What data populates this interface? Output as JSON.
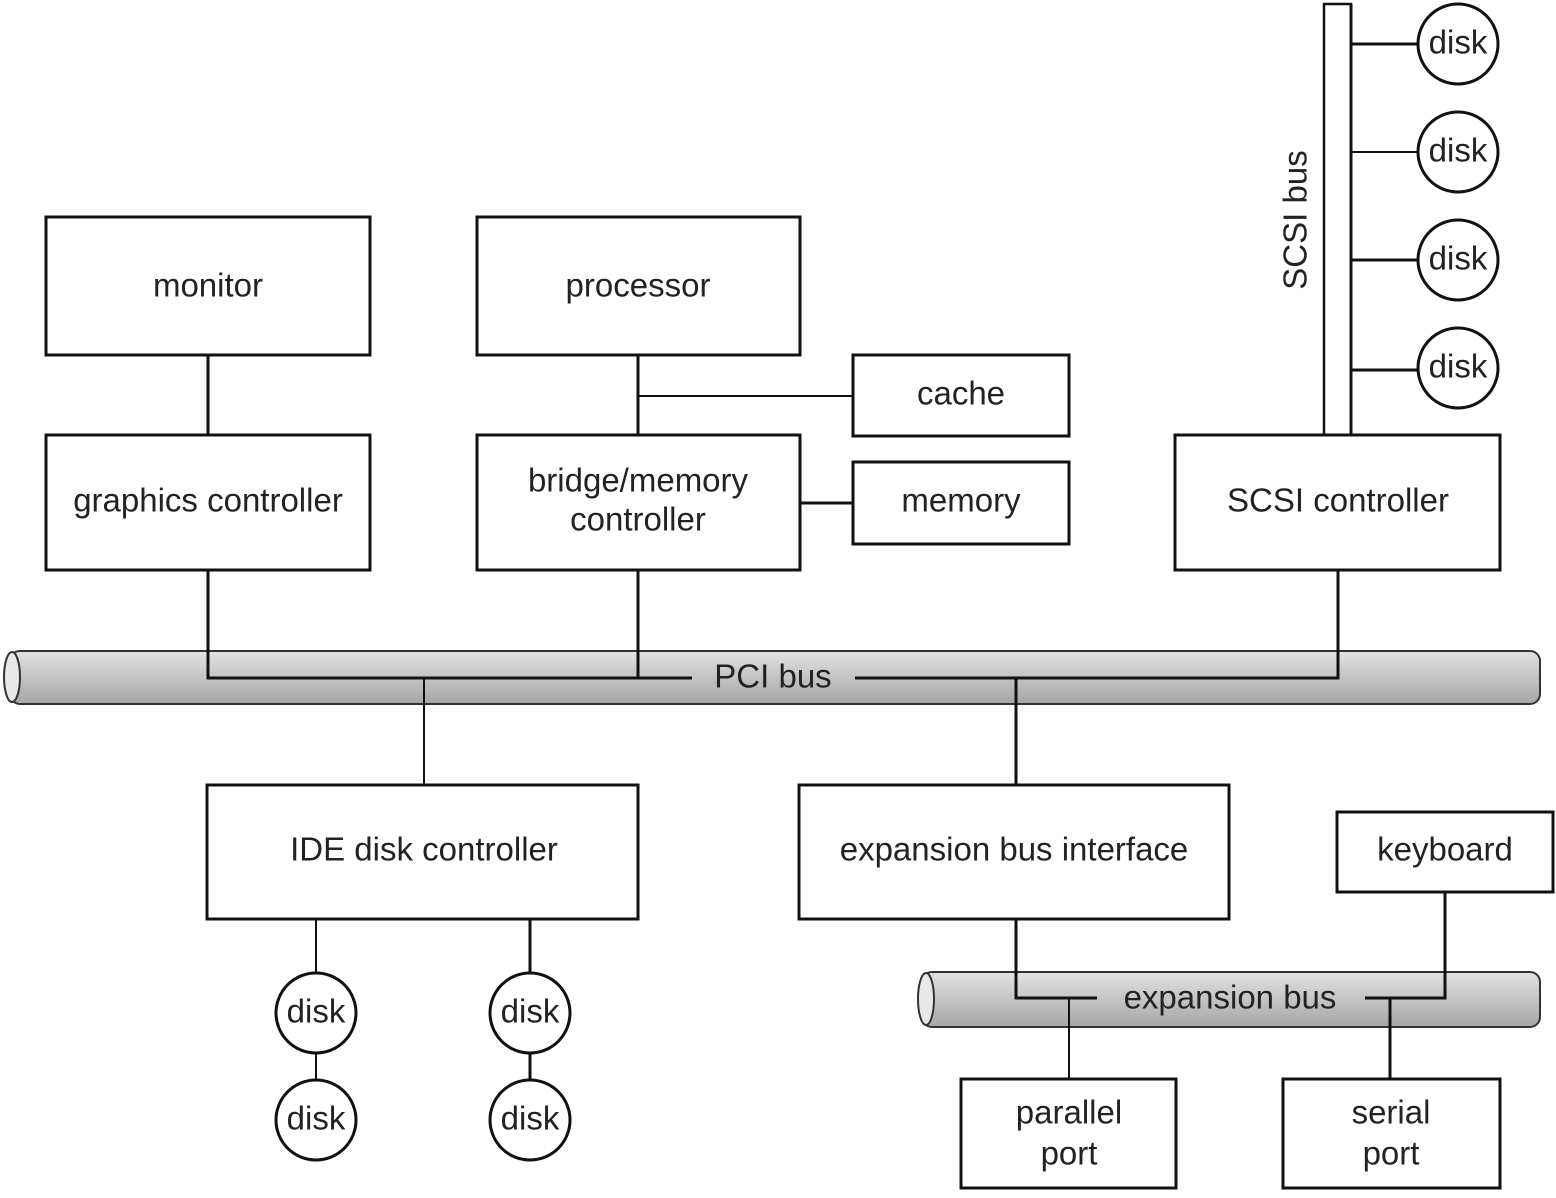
{
  "components": {
    "monitor": "monitor",
    "graphics_controller": "graphics controller",
    "processor": "processor",
    "cache": "cache",
    "bridge_line1": "bridge/memory",
    "bridge_line2": "controller",
    "memory": "memory",
    "scsi_controller": "SCSI controller",
    "ide_controller": "IDE disk controller",
    "expansion_interface": "expansion bus interface",
    "keyboard": "keyboard",
    "parallel_line1": "parallel",
    "parallel_line2": "port",
    "serial_line1": "serial",
    "serial_line2": "port"
  },
  "buses": {
    "pci": "PCI bus",
    "scsi": "SCSI bus",
    "expansion": "expansion bus"
  },
  "disk_label": "disk",
  "colors": {
    "bus_fill_top": "#e0e0e0",
    "bus_fill_bottom": "#a8a8a8",
    "stroke": "#111111"
  }
}
